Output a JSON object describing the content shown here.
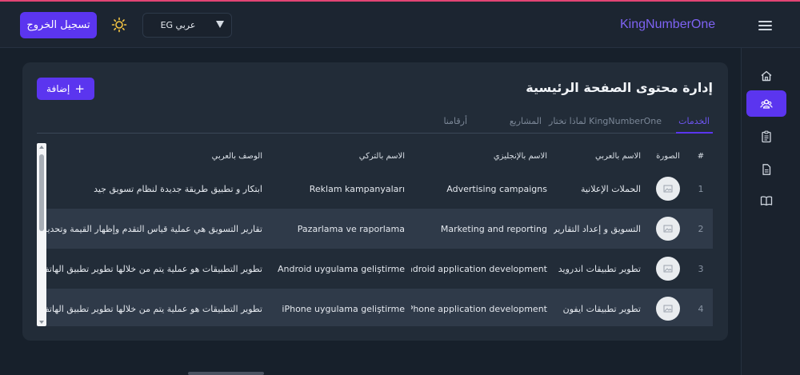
{
  "header": {
    "logout_label": "تسجيل الخروج",
    "language_value": "EG عربي",
    "brand": "KingNumberOne"
  },
  "page": {
    "title": "إدارة محتوى الصفحة الرئيسية",
    "add_label": "إضافة",
    "tabs": [
      {
        "label": "الخدمات",
        "active": true
      },
      {
        "label": "لماذا تختار KingNumberOne",
        "active": false
      },
      {
        "label": "المشاريع",
        "active": false
      },
      {
        "label": "أرقامنا",
        "active": false
      }
    ]
  },
  "table": {
    "headers": [
      "#",
      "الصورة",
      "الاسم بالعربي",
      "الاسم بالإنجليزي",
      "الاسم بالتركي",
      "الوصف بالعربي"
    ],
    "rows": [
      {
        "num": "1",
        "ar": "الحملات الإعلانية",
        "en": "Advertising campaigns",
        "tr": "Reklam kampanyaları",
        "desc": "ابتكار و تطبيق طريقة جديدة لنظام تسويق جيد"
      },
      {
        "num": "2",
        "ar": "التسويق و إعداد التقارير",
        "en": "Marketing and reporting",
        "tr": "Pazarlama ve raporlama",
        "desc": "تقارير التسويق هي عملية قياس التقدم وإظهار القيمة وتحديد"
      },
      {
        "num": "3",
        "ar": "تطوير تطبيقات اندرويد",
        "en": "Android application development",
        "tr": "Android uygulama geliştirme",
        "desc": "تطوير التطبيقات هو عملية يتم من خلالها تطوير تطبيق الهاتف"
      },
      {
        "num": "4",
        "ar": "تطوير تطبيقات ايفون",
        "en": "iPhone application development",
        "tr": "iPhone uygulama geliştirme",
        "desc": "تطوير التطبيقات هو عملية يتم من خلالها تطوير تطبيق الهاتف"
      }
    ]
  },
  "colors": {
    "accent": "#5b35ef",
    "background": "#17202b",
    "card": "#222c38"
  }
}
